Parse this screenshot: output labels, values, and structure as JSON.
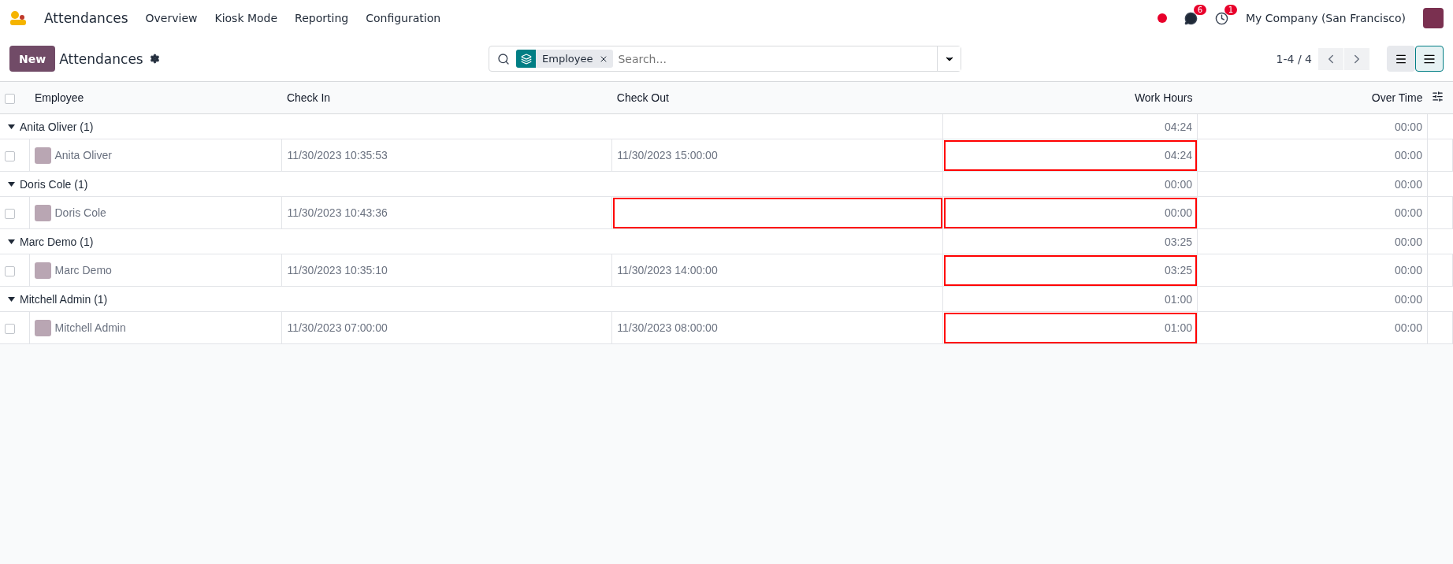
{
  "navbar": {
    "app_name": "Attendances",
    "menu": [
      "Overview",
      "Kiosk Mode",
      "Reporting",
      "Configuration"
    ],
    "messages_count": "6",
    "activities_count": "1",
    "company": "My Company (San Francisco)"
  },
  "control_panel": {
    "new_button": "New",
    "title": "Attendances",
    "search": {
      "facet": "Employee",
      "placeholder": "Search..."
    },
    "pager": "1-4 / 4",
    "views": [
      {
        "kind": "activity",
        "selected": false
      },
      {
        "kind": "list",
        "selected": true
      }
    ]
  },
  "table": {
    "select_all_checked": false,
    "columns": [
      "Employee",
      "Check In",
      "Check Out",
      "Work Hours",
      "Over Time"
    ],
    "groups": [
      {
        "label": "Anita Oliver (1)",
        "expanded": true,
        "work_hours": "04:24",
        "over_time": "00:00",
        "rows": [
          {
            "checked": false,
            "employee": "Anita Oliver",
            "check_in": "11/30/2023 10:35:53",
            "check_out": "11/30/2023 15:00:00",
            "work_hours": "04:24",
            "over_time": "00:00",
            "check_out_marked": false,
            "work_hours_marked": true
          }
        ]
      },
      {
        "label": "Doris Cole (1)",
        "expanded": true,
        "work_hours": "00:00",
        "over_time": "00:00",
        "rows": [
          {
            "checked": false,
            "employee": "Doris Cole",
            "check_in": "11/30/2023 10:43:36",
            "work_hours": "00:00",
            "over_time": "00:00",
            "check_out_marked": true,
            "work_hours_marked": true
          }
        ]
      },
      {
        "label": "Marc Demo (1)",
        "expanded": true,
        "work_hours": "03:25",
        "over_time": "00:00",
        "rows": [
          {
            "checked": false,
            "employee": "Marc Demo",
            "check_in": "11/30/2023 10:35:10",
            "check_out": "11/30/2023 14:00:00",
            "work_hours": "03:25",
            "over_time": "00:00",
            "check_out_marked": false,
            "work_hours_marked": true
          }
        ]
      },
      {
        "label": "Mitchell Admin (1)",
        "expanded": true,
        "work_hours": "01:00",
        "over_time": "00:00",
        "rows": [
          {
            "checked": false,
            "employee": "Mitchell Admin",
            "check_in": "11/30/2023 07:00:00",
            "check_out": "11/30/2023 08:00:00",
            "work_hours": "01:00",
            "over_time": "00:00",
            "check_out_marked": false,
            "work_hours_marked": true
          }
        ]
      }
    ]
  }
}
